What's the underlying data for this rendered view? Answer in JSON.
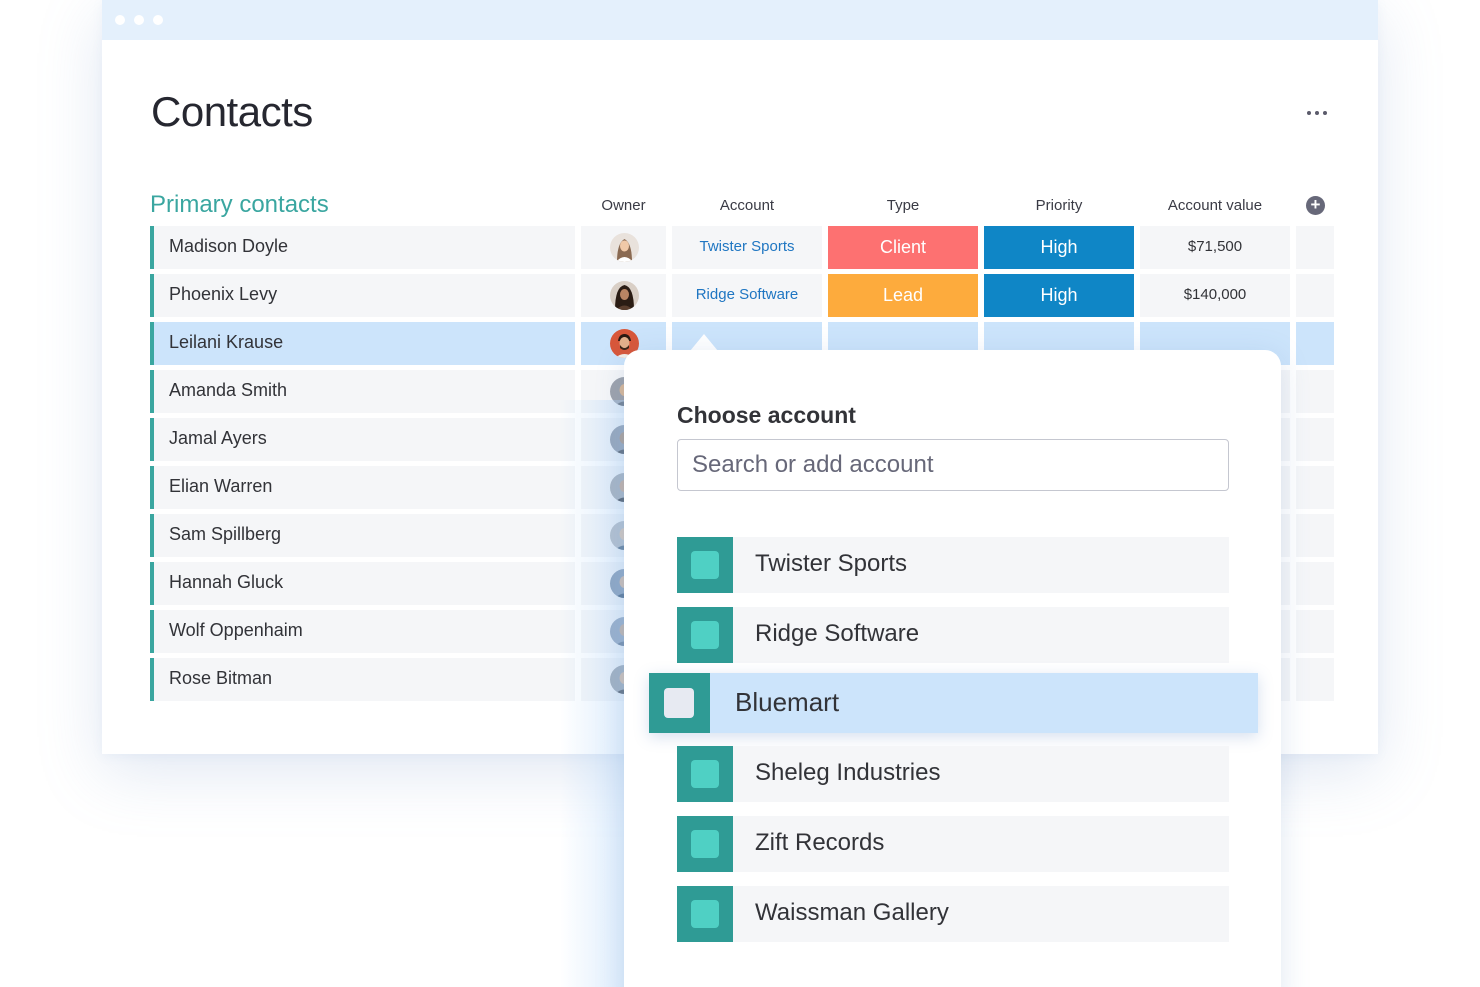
{
  "window": {
    "title_dots": 3
  },
  "page": {
    "title": "Contacts"
  },
  "table": {
    "group_title": "Primary contacts",
    "columns": {
      "owner": "Owner",
      "account": "Account",
      "type": "Type",
      "priority": "Priority",
      "account_value": "Account value"
    },
    "rows": [
      {
        "name": "Madison Doyle",
        "owner_avatar": "woman-avatar",
        "account": "Twister Sports",
        "type": "Client",
        "priority": "High",
        "account_value": "$71,500"
      },
      {
        "name": "Phoenix Levy",
        "owner_avatar": "woman-avatar-dark-hair",
        "account": "Ridge Software",
        "type": "Lead",
        "priority": "High",
        "account_value": "$140,000"
      },
      {
        "name": "Leilani Krause",
        "owner_avatar": "man-avatar",
        "account": "",
        "type": "",
        "priority": "",
        "account_value": "",
        "selected": true
      },
      {
        "name": "Amanda Smith"
      },
      {
        "name": "Jamal Ayers"
      },
      {
        "name": "Elian Warren"
      },
      {
        "name": "Sam Spillberg"
      },
      {
        "name": "Hannah Gluck"
      },
      {
        "name": "Wolf Oppenhaim"
      },
      {
        "name": "Rose Bitman"
      }
    ]
  },
  "status_colors": {
    "Client": "#fd7171",
    "Lead": "#fdab3d",
    "High": "#0f86c6",
    "group": "#3aa6a0",
    "selected_row": "#cce4fb"
  },
  "account_picker": {
    "title": "Choose account",
    "search_placeholder": "Search or add account",
    "options": [
      {
        "label": "Twister Sports"
      },
      {
        "label": "Ridge Software"
      },
      {
        "label": "Bluemart",
        "highlighted": true
      },
      {
        "label": "Sheleg Industries"
      },
      {
        "label": "Zift Records"
      },
      {
        "label": "Waissman Gallery"
      }
    ]
  }
}
